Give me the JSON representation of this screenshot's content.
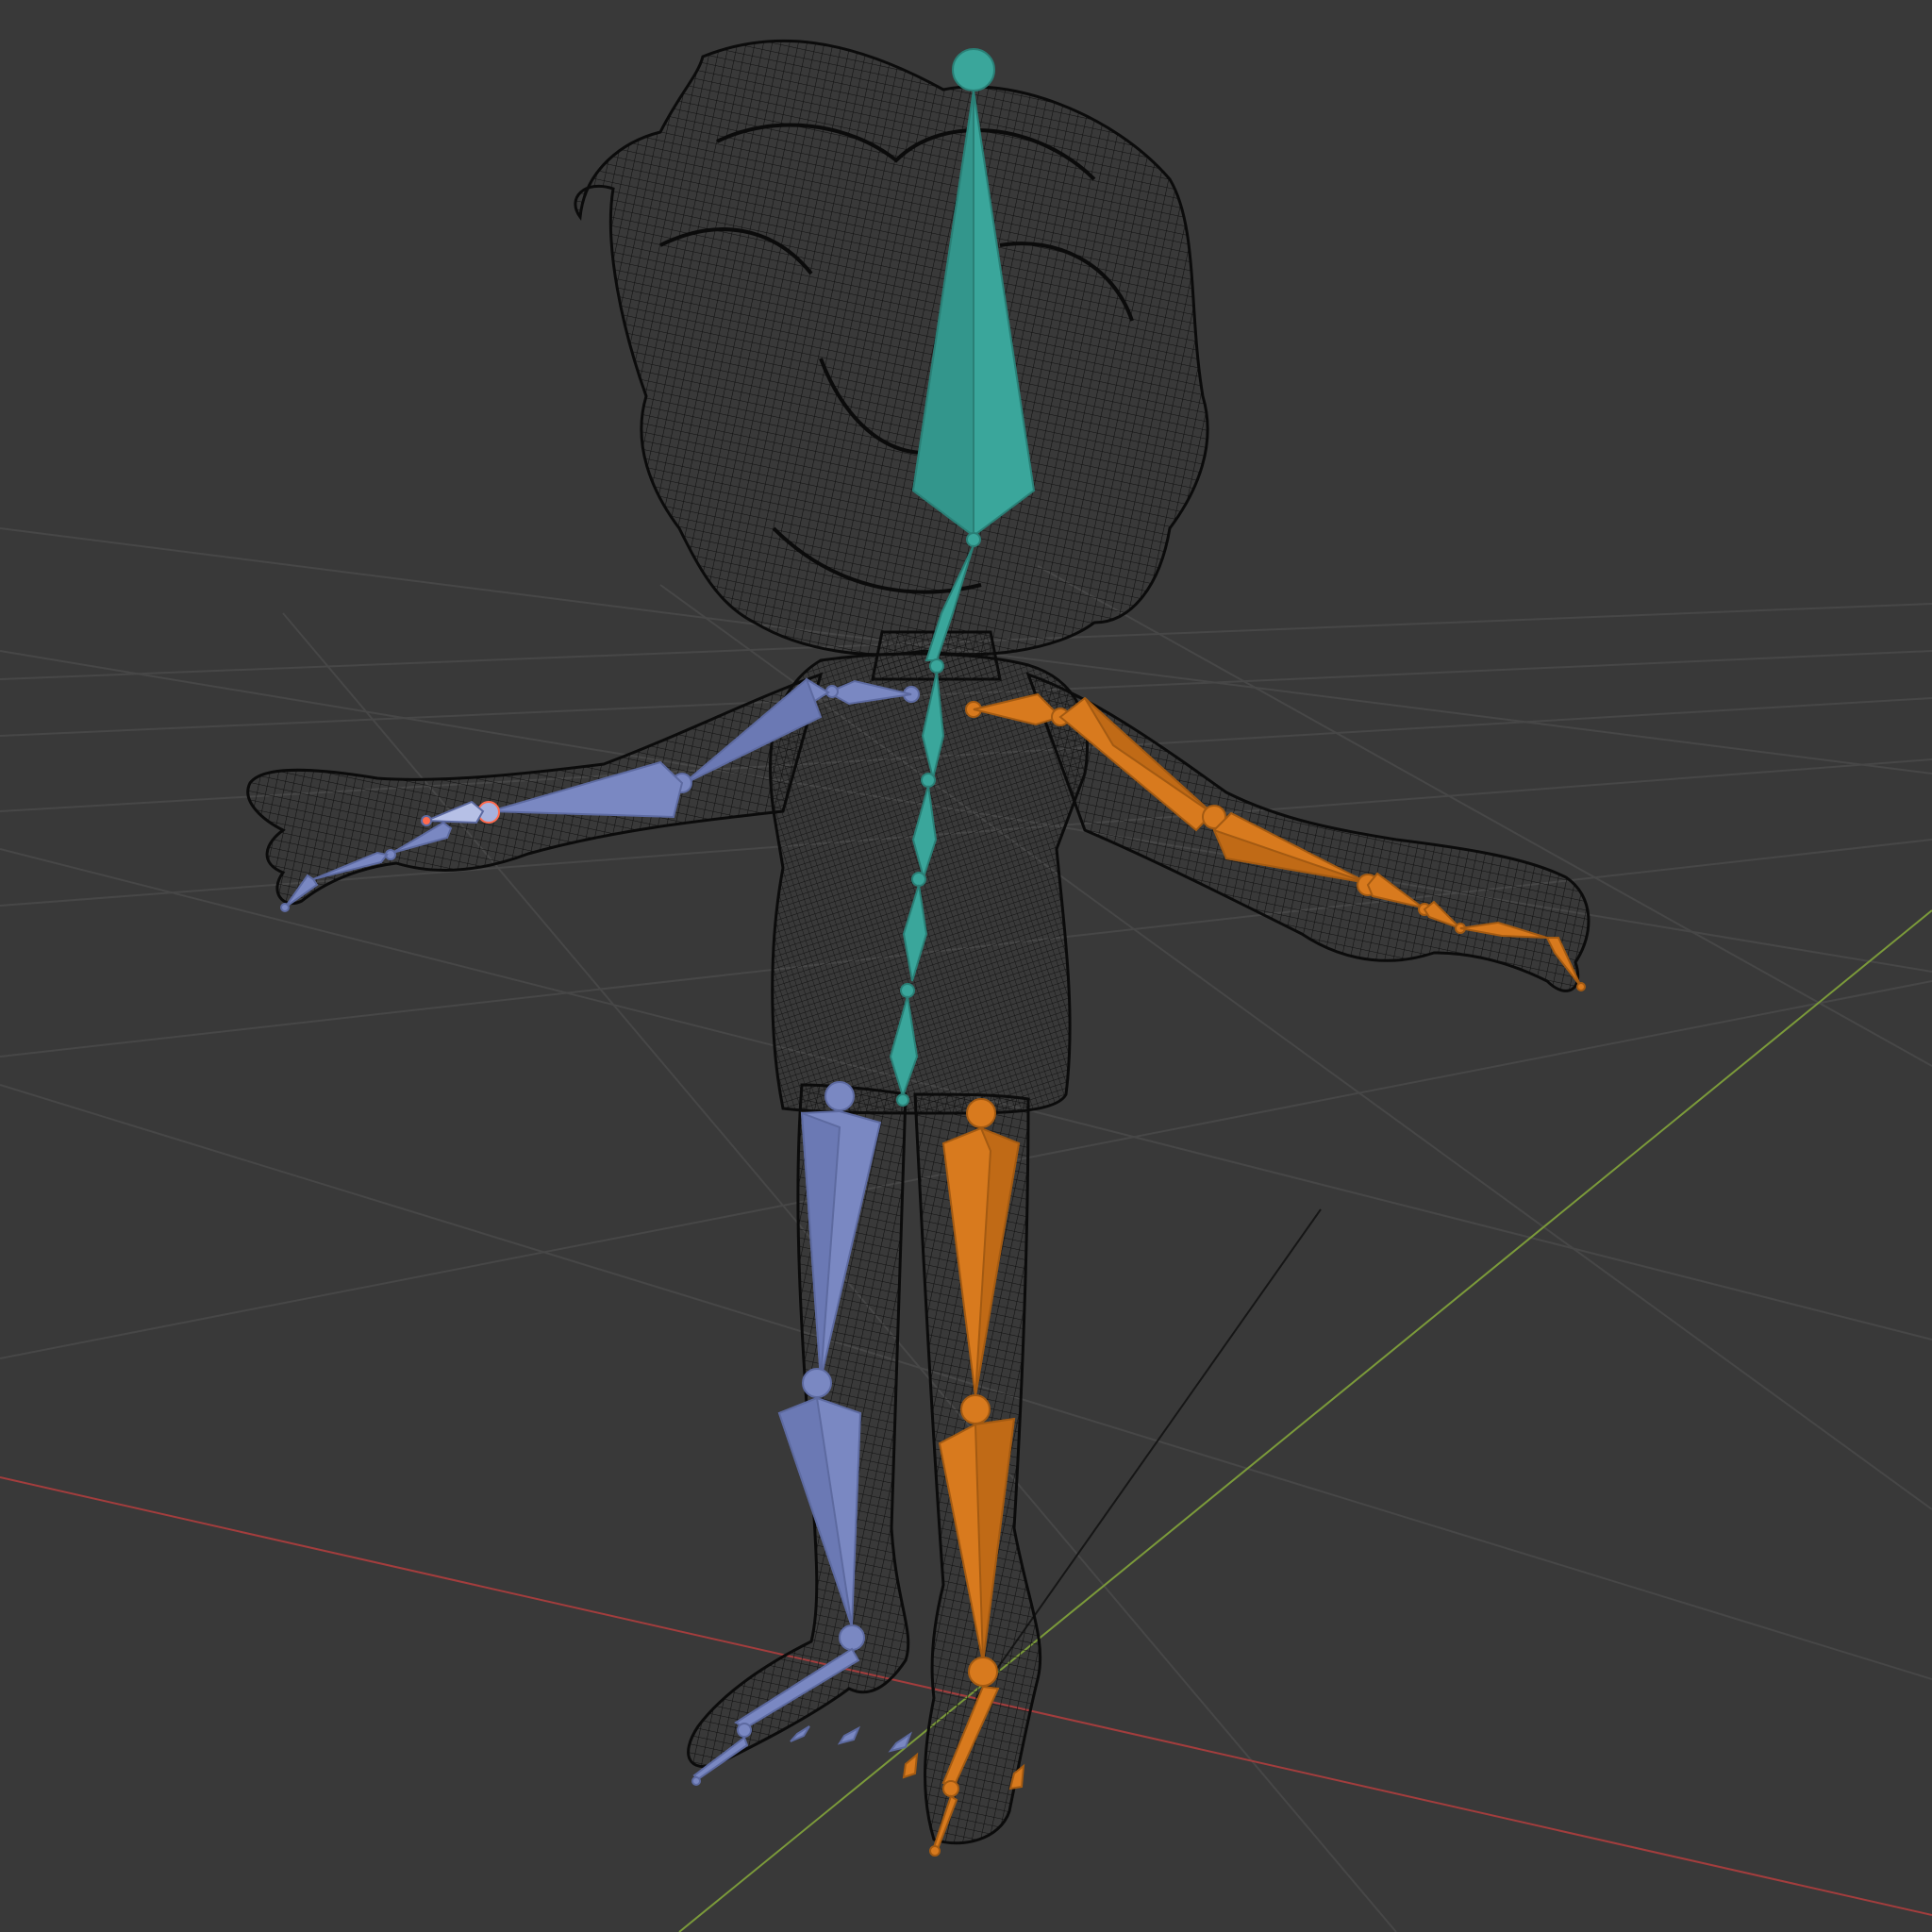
{
  "viewport": {
    "background_color": "#393939",
    "grid_color": "#4a4a4a",
    "x_axis_color": "#a33d3d",
    "y_axis_color": "#7b9a3a",
    "wireframe_color": "#0d0d0d",
    "spine_bone_color": "#3aa69b",
    "left_side_bone_color": "#7a88c2",
    "right_side_bone_color": "#d87a1e",
    "bone_joint_highlight": "#ff6a4d"
  },
  "scene": {
    "object": "character-wireframe-mesh",
    "armature": "character-armature",
    "mode": "wireframe"
  }
}
